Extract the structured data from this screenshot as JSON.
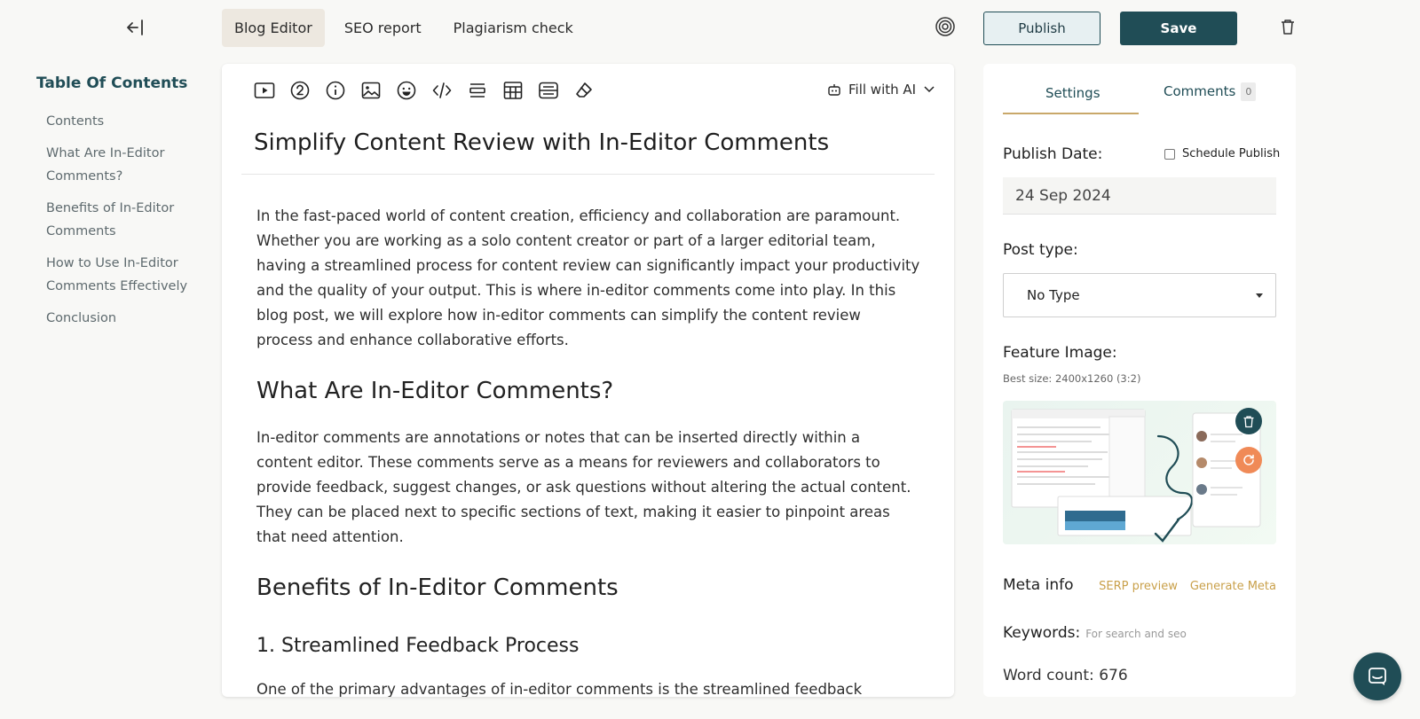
{
  "topbar": {
    "tabs": [
      {
        "label": "Blog Editor",
        "active": true
      },
      {
        "label": "SEO report",
        "active": false
      },
      {
        "label": "Plagiarism check",
        "active": false
      }
    ],
    "publish_label": "Publish",
    "save_label": "Save"
  },
  "toc": {
    "title": "Table Of Contents",
    "items": [
      "Contents",
      "What Are In-Editor Comments?",
      "Benefits of In-Editor Comments",
      "How to Use In-Editor Comments Effectively",
      "Conclusion"
    ]
  },
  "editor": {
    "toolbar_icons": [
      "video-icon",
      "number-icon",
      "info-icon",
      "image-icon",
      "emoji-icon",
      "code-icon",
      "divider-icon",
      "table-icon",
      "layout-icon",
      "eraser-icon"
    ],
    "fill_ai_label": "Fill with AI",
    "title": "Simplify Content Review with In-Editor Comments",
    "intro": "In the fast-paced world of content creation, efficiency and collaboration are paramount. Whether you are working as a solo content creator or part of a larger editorial team, having a streamlined process for content review can significantly impact your productivity and the quality of your output. This is where in-editor comments come into play. In this blog post, we will explore how in-editor comments can simplify the content review process and enhance collaborative efforts.",
    "h2_what": "What Are In-Editor Comments?",
    "what_paragraph": "In-editor comments are annotations or notes that can be inserted directly within a content editor. These comments serve as a means for reviewers and collaborators to provide feedback, suggest changes, or ask questions without altering the actual content. They can be placed next to specific sections of text, making it easier to pinpoint areas that need attention.",
    "h2_benefits": "Benefits of In-Editor Comments",
    "h3_streamlined": "1. Streamlined Feedback Process",
    "streamlined_paragraph": "One of the primary advantages of in-editor comments is the streamlined feedback process."
  },
  "settings": {
    "tab_settings": "Settings",
    "tab_comments": "Comments",
    "comments_count": "0",
    "publish_date_label": "Publish Date:",
    "schedule_label": "Schedule Publish",
    "publish_date_value": "24 Sep 2024",
    "post_type_label": "Post type:",
    "post_type_value": "No Type",
    "feature_image_label": "Feature Image:",
    "feature_image_hint": "Best size: 2400x1260 (3:2)",
    "meta_title": "Meta info",
    "serp_preview": "SERP preview",
    "generate_meta": "Generate Meta",
    "keywords_label": "Keywords:",
    "keywords_placeholder": "For search and seo",
    "word_count": "Word count: 676"
  },
  "colors": {
    "accent": "#204d56",
    "gold": "#c9a04a",
    "orange": "#f08a57"
  }
}
